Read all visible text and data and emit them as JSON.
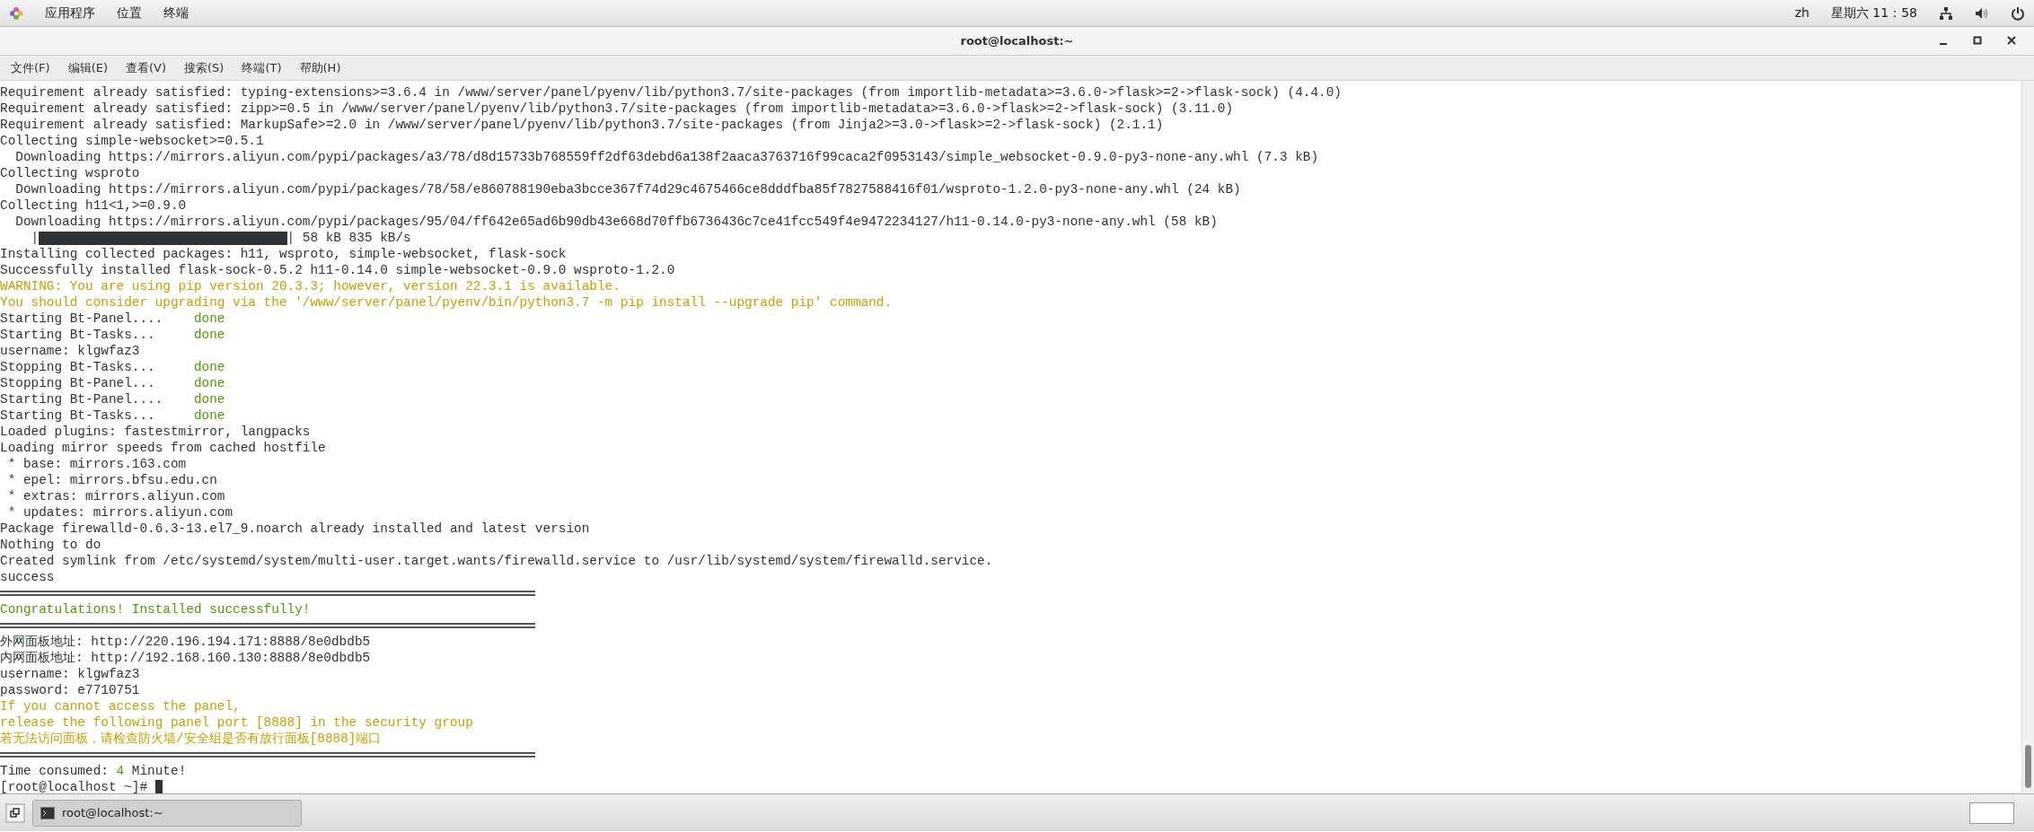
{
  "top_bar": {
    "menus": [
      "应用程序",
      "位置",
      "终端"
    ],
    "input_method": "zh",
    "clock": "星期六 11：58"
  },
  "window": {
    "title": "root@localhost:~"
  },
  "menu_bar": [
    "文件(F)",
    "编辑(E)",
    "查看(V)",
    "搜索(S)",
    "终端(T)",
    "帮助(H)"
  ],
  "terminal": {
    "lines": [
      {
        "kind": "text",
        "segments": [
          {
            "text": "Requirement already satisfied: typing-extensions>=3.6.4 in /www/server/panel/pyenv/lib/python3.7/site-packages (from importlib-metadata>=3.6.0->flask>=2->flask-sock) (4.4.0)",
            "kind": "plain"
          }
        ]
      },
      {
        "kind": "text",
        "segments": [
          {
            "text": "Requirement already satisfied: zipp>=0.5 in /www/server/panel/pyenv/lib/python3.7/site-packages (from importlib-metadata>=3.6.0->flask>=2->flask-sock) (3.11.0)",
            "kind": "plain"
          }
        ]
      },
      {
        "kind": "text",
        "segments": [
          {
            "text": "Requirement already satisfied: MarkupSafe>=2.0 in /www/server/panel/pyenv/lib/python3.7/site-packages (from Jinja2>=3.0->flask>=2->flask-sock) (2.1.1)",
            "kind": "plain"
          }
        ]
      },
      {
        "kind": "text",
        "segments": [
          {
            "text": "Collecting simple-websocket>=0.5.1",
            "kind": "plain"
          }
        ]
      },
      {
        "kind": "text",
        "segments": [
          {
            "text": "  Downloading https://mirrors.aliyun.com/pypi/packages/a3/78/d8d15733b768559ff2df63debd6a138f2aaca3763716f99caca2f0953143/simple_websocket-0.9.0-py3-none-any.whl (7.3 kB)",
            "kind": "plain"
          }
        ]
      },
      {
        "kind": "text",
        "segments": [
          {
            "text": "Collecting wsproto",
            "kind": "plain"
          }
        ]
      },
      {
        "kind": "text",
        "segments": [
          {
            "text": "  Downloading https://mirrors.aliyun.com/pypi/packages/78/58/e860788190eba3bcce367f74d29c4675466ce8dddfba85f7827588416f01/wsproto-1.2.0-py3-none-any.whl (24 kB)",
            "kind": "plain"
          }
        ]
      },
      {
        "kind": "text",
        "segments": [
          {
            "text": "Collecting h11<1,>=0.9.0",
            "kind": "plain"
          }
        ]
      },
      {
        "kind": "text",
        "segments": [
          {
            "text": "  Downloading https://mirrors.aliyun.com/pypi/packages/95/04/ff642e65ad6b90db43e668d70ffb6736436c7ce41fcc549f4e9472234127/h11-0.14.0-py3-none-any.whl (58 kB)",
            "kind": "plain"
          }
        ]
      },
      {
        "kind": "progress",
        "prefix": "    |",
        "level": 1,
        "reading": "| 58 kB 835 kB/s"
      },
      {
        "kind": "text",
        "segments": [
          {
            "text": "Installing collected packages: h11, wsproto, simple-websocket, flask-sock",
            "kind": "plain"
          }
        ]
      },
      {
        "kind": "text",
        "segments": [
          {
            "text": "Successfully installed flask-sock-0.5.2 h11-0.14.0 simple-websocket-0.9.0 wsproto-1.2.0",
            "kind": "plain"
          }
        ]
      },
      {
        "kind": "text",
        "segments": [
          {
            "text": "WARNING: You are using pip version 20.3.3; however, version 22.3.1 is available.",
            "kind": "yellow"
          }
        ]
      },
      {
        "kind": "text",
        "segments": [
          {
            "text": "You should consider upgrading via the '/www/server/panel/pyenv/bin/python3.7 -m pip install --upgrade pip' command.",
            "kind": "yellow"
          }
        ]
      },
      {
        "kind": "text",
        "segments": [
          {
            "text": "Starting Bt-Panel....    ",
            "kind": "plain"
          },
          {
            "text": "done",
            "kind": "green"
          }
        ]
      },
      {
        "kind": "text",
        "segments": [
          {
            "text": "Starting Bt-Tasks...     ",
            "kind": "plain"
          },
          {
            "text": "done",
            "kind": "green"
          }
        ]
      },
      {
        "kind": "text",
        "segments": [
          {
            "text": "username: klgwfaz3",
            "kind": "plain"
          }
        ]
      },
      {
        "kind": "text",
        "segments": [
          {
            "text": "Stopping Bt-Tasks...     ",
            "kind": "plain"
          },
          {
            "text": "done",
            "kind": "green"
          }
        ]
      },
      {
        "kind": "text",
        "segments": [
          {
            "text": "Stopping Bt-Panel...     ",
            "kind": "plain"
          },
          {
            "text": "done",
            "kind": "green"
          }
        ]
      },
      {
        "kind": "text",
        "segments": [
          {
            "text": "Starting Bt-Panel....    ",
            "kind": "plain"
          },
          {
            "text": "done",
            "kind": "green"
          }
        ]
      },
      {
        "kind": "text",
        "segments": [
          {
            "text": "Starting Bt-Tasks...     ",
            "kind": "plain"
          },
          {
            "text": "done",
            "kind": "green"
          }
        ]
      },
      {
        "kind": "text",
        "segments": [
          {
            "text": "Loaded plugins: fastestmirror, langpacks",
            "kind": "plain"
          }
        ]
      },
      {
        "kind": "text",
        "segments": [
          {
            "text": "Loading mirror speeds from cached hostfile",
            "kind": "plain"
          }
        ]
      },
      {
        "kind": "text",
        "segments": [
          {
            "text": " * base: mirrors.163.com",
            "kind": "plain"
          }
        ]
      },
      {
        "kind": "text",
        "segments": [
          {
            "text": " * epel: mirrors.bfsu.edu.cn",
            "kind": "plain"
          }
        ]
      },
      {
        "kind": "text",
        "segments": [
          {
            "text": " * extras: mirrors.aliyun.com",
            "kind": "plain"
          }
        ]
      },
      {
        "kind": "text",
        "segments": [
          {
            "text": " * updates: mirrors.aliyun.com",
            "kind": "plain"
          }
        ]
      },
      {
        "kind": "text",
        "segments": [
          {
            "text": "Package firewalld-0.6.3-13.el7_9.noarch already installed and latest version",
            "kind": "plain"
          }
        ]
      },
      {
        "kind": "text",
        "segments": [
          {
            "text": "Nothing to do",
            "kind": "plain"
          }
        ]
      },
      {
        "kind": "text",
        "segments": [
          {
            "text": "Created symlink from /etc/systemd/system/multi-user.target.wants/firewalld.service to /usr/lib/systemd/system/firewalld.service.",
            "kind": "plain"
          }
        ]
      },
      {
        "kind": "text",
        "segments": [
          {
            "text": "success",
            "kind": "plain"
          }
        ]
      },
      {
        "kind": "rule"
      },
      {
        "kind": "text",
        "segments": [
          {
            "text": "Congratulations! Installed successfully!",
            "kind": "green"
          }
        ]
      },
      {
        "kind": "rule"
      },
      {
        "kind": "text",
        "segments": [
          {
            "text": "外网面板地址: http://220.196.194.171:8888/8e0dbdb5",
            "kind": "plain"
          }
        ]
      },
      {
        "kind": "text",
        "segments": [
          {
            "text": "内网面板地址: http://192.168.160.130:8888/8e0dbdb5",
            "kind": "plain"
          }
        ]
      },
      {
        "kind": "text",
        "segments": [
          {
            "text": "username: klgwfaz3",
            "kind": "plain"
          }
        ]
      },
      {
        "kind": "text",
        "segments": [
          {
            "text": "password: e7710751",
            "kind": "plain"
          }
        ]
      },
      {
        "kind": "text",
        "segments": [
          {
            "text": "If you cannot access the panel,",
            "kind": "yellow"
          }
        ]
      },
      {
        "kind": "text",
        "segments": [
          {
            "text": "release the following panel port [8888] in the security group",
            "kind": "yellow"
          }
        ]
      },
      {
        "kind": "text",
        "segments": [
          {
            "text": "若无法访问面板，请检查防火墙/安全组是否有放行面板[8888]端口",
            "kind": "yellow"
          }
        ]
      },
      {
        "kind": "rule"
      },
      {
        "kind": "text",
        "segments": [
          {
            "text": "Time consumed: ",
            "kind": "plain"
          },
          {
            "text": "4",
            "kind": "green"
          },
          {
            "text": " Minute!",
            "kind": "plain"
          }
        ]
      },
      {
        "kind": "prompt",
        "text": "[root@localhost ~]# "
      }
    ]
  },
  "taskbar": {
    "tasks": [
      {
        "label": "root@localhost:~",
        "selected": true
      }
    ]
  }
}
